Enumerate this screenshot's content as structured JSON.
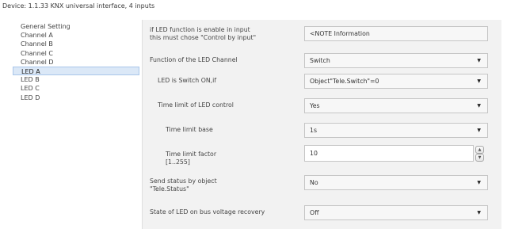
{
  "window": {
    "title": "Device: 1.1.33  KNX universal interface, 4 inputs"
  },
  "sidebar": {
    "items": [
      {
        "label": "General Setting",
        "selected": false
      },
      {
        "label": "Channel A",
        "selected": false
      },
      {
        "label": "Channel B",
        "selected": false
      },
      {
        "label": "Channel C",
        "selected": false
      },
      {
        "label": "Channel D",
        "selected": false
      },
      {
        "label": "LED A",
        "selected": true
      },
      {
        "label": "LED B",
        "selected": false
      },
      {
        "label": "LED C",
        "selected": false
      },
      {
        "label": "LED D",
        "selected": false
      }
    ]
  },
  "params": {
    "note": {
      "label_line1": "if LED function is enable in input",
      "label_line2": "this must chose \"Control by input\"",
      "value": "<NOTE Information"
    },
    "function": {
      "label": "Function of the LED Channel",
      "value": "Switch"
    },
    "switch_on_if": {
      "label": "LED is Switch ON,if",
      "value": "Object\"Tele.Switch\"=0"
    },
    "time_limit": {
      "label": "Time limit of LED control",
      "value": "Yes"
    },
    "time_base": {
      "label": "Time limit base",
      "value": "1s"
    },
    "time_factor": {
      "label_line1": "Time limit factor",
      "label_line2": "[1..255]",
      "value": "10"
    },
    "send_status": {
      "label_line1": "Send status by object",
      "label_line2": "\"Tele.Status\"",
      "value": "No"
    },
    "bus_recovery": {
      "label": "State of LED on bus voltage recovery",
      "value": "Off"
    }
  },
  "icons": {
    "dropdown": "chevron-down-icon",
    "spin_up": "arrow-up-icon",
    "spin_down": "arrow-down-icon"
  }
}
